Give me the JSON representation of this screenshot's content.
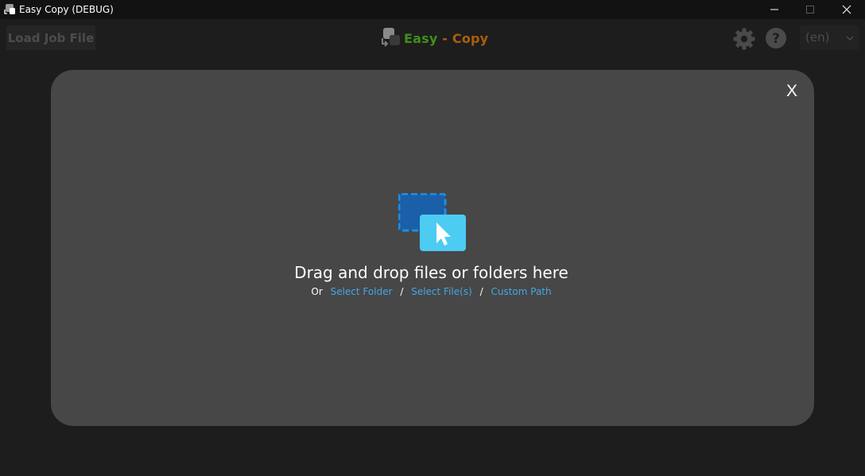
{
  "window": {
    "title": "Easy Copy (DEBUG)",
    "icon": "app-icon",
    "controls": [
      "minimize-icon",
      "maximize-icon",
      "close-icon"
    ]
  },
  "toolbar": {
    "load_job_label": "Load Job File",
    "brand": {
      "easy": "Easy",
      "sep": " - ",
      "copy": "Copy"
    },
    "settings_icon": "gear-icon",
    "help_icon": "help-icon",
    "language": {
      "selected": "(en)"
    }
  },
  "drop_panel": {
    "close_label": "X",
    "icon": "drag-drop-icon",
    "heading": "Drag and drop files or folders here",
    "or_label": "Or",
    "select_folder": "Select Folder",
    "separator": "/",
    "select_files": "Select File(s)",
    "custom_path": "Custom Path"
  },
  "colors": {
    "background": "#1d1d1d",
    "titlebar": "#121212",
    "panel": "#474747",
    "link": "#44a6e6",
    "brand_green": "#3e8f1c",
    "brand_orange": "#a9600b",
    "icon_blue_dark": "#1b6fc7",
    "icon_blue_light": "#4ccbf3"
  }
}
